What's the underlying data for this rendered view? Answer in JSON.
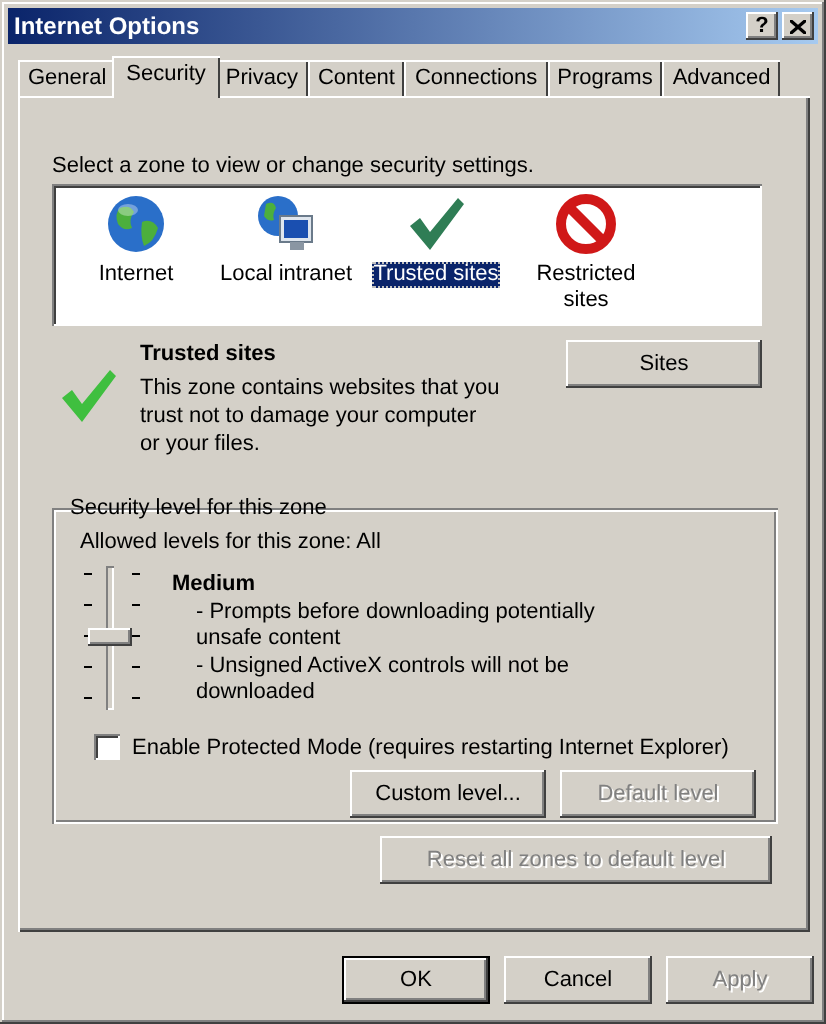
{
  "window": {
    "title": "Internet Options",
    "help_button": "?"
  },
  "tabs": [
    {
      "label": "General",
      "selected": false
    },
    {
      "label": "Security",
      "selected": true
    },
    {
      "label": "Privacy",
      "selected": false
    },
    {
      "label": "Content",
      "selected": false
    },
    {
      "label": "Connections",
      "selected": false
    },
    {
      "label": "Programs",
      "selected": false
    },
    {
      "label": "Advanced",
      "selected": false
    }
  ],
  "zones": {
    "prompt": "Select a zone to view or change security settings.",
    "items": [
      {
        "label": "Internet",
        "kind": "internet",
        "selected": false
      },
      {
        "label": "Local intranet",
        "kind": "intranet",
        "selected": false
      },
      {
        "label": "Trusted sites",
        "kind": "trusted",
        "selected": true
      },
      {
        "label": "Restricted sites",
        "kind": "restricted",
        "selected": false
      }
    ]
  },
  "zone_info": {
    "kind": "trusted",
    "title": "Trusted sites",
    "description": "This zone contains websites that you trust not to damage your computer or your files.",
    "sites_button": "Sites"
  },
  "security_level": {
    "legend": "Security level for this zone",
    "allowed": "Allowed levels for this zone: All",
    "level": 0.5,
    "name": "Medium",
    "details": [
      "- Prompts before downloading potentially unsafe content",
      "- Unsigned ActiveX controls will not be downloaded"
    ],
    "protected_mode": {
      "label": "Enable Protected Mode (requires restarting Internet Explorer)",
      "checked": false
    },
    "buttons": [
      {
        "label": "Custom level...",
        "disabled": false
      },
      {
        "label": "Default level",
        "disabled": true
      }
    ]
  },
  "reset_button": {
    "label": "Reset all zones to default level",
    "disabled": true
  },
  "footer_buttons": [
    {
      "label": "OK",
      "disabled": false,
      "default": true
    },
    {
      "label": "Cancel",
      "disabled": false,
      "default": false
    },
    {
      "label": "Apply",
      "disabled": true,
      "default": false
    }
  ]
}
